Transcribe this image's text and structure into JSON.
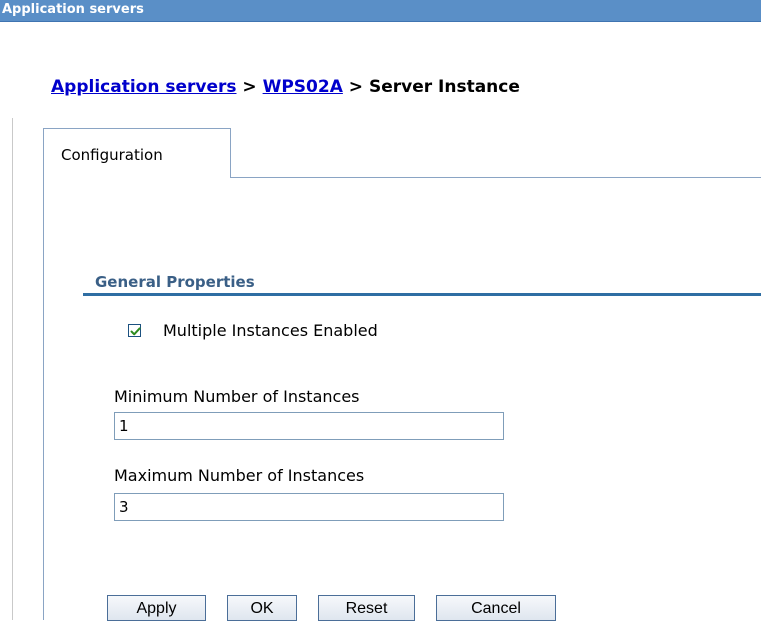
{
  "window": {
    "title": "Application servers"
  },
  "breadcrumb": {
    "link1": "Application servers",
    "sep1": " > ",
    "link2": "WPS02A",
    "sep2": " > ",
    "current": "Server Instance"
  },
  "tabs": [
    {
      "label": "Configuration",
      "active": true
    }
  ],
  "general_properties": {
    "heading": "General Properties",
    "multiple_instances": {
      "label": "Multiple Instances Enabled",
      "checked": true
    },
    "min_instances": {
      "label": "Minimum Number of Instances",
      "value": "1"
    },
    "max_instances": {
      "label": "Maximum Number of Instances",
      "value": "3"
    }
  },
  "buttons": {
    "apply": "Apply",
    "ok": "OK",
    "reset": "Reset",
    "cancel": "Cancel"
  },
  "colors": {
    "title_bar": "#5a8fc7",
    "link": "#0000cc",
    "section_heading": "#3a5f86",
    "section_rule": "#2f6ea3",
    "checkmark": "#2e8b1f"
  }
}
